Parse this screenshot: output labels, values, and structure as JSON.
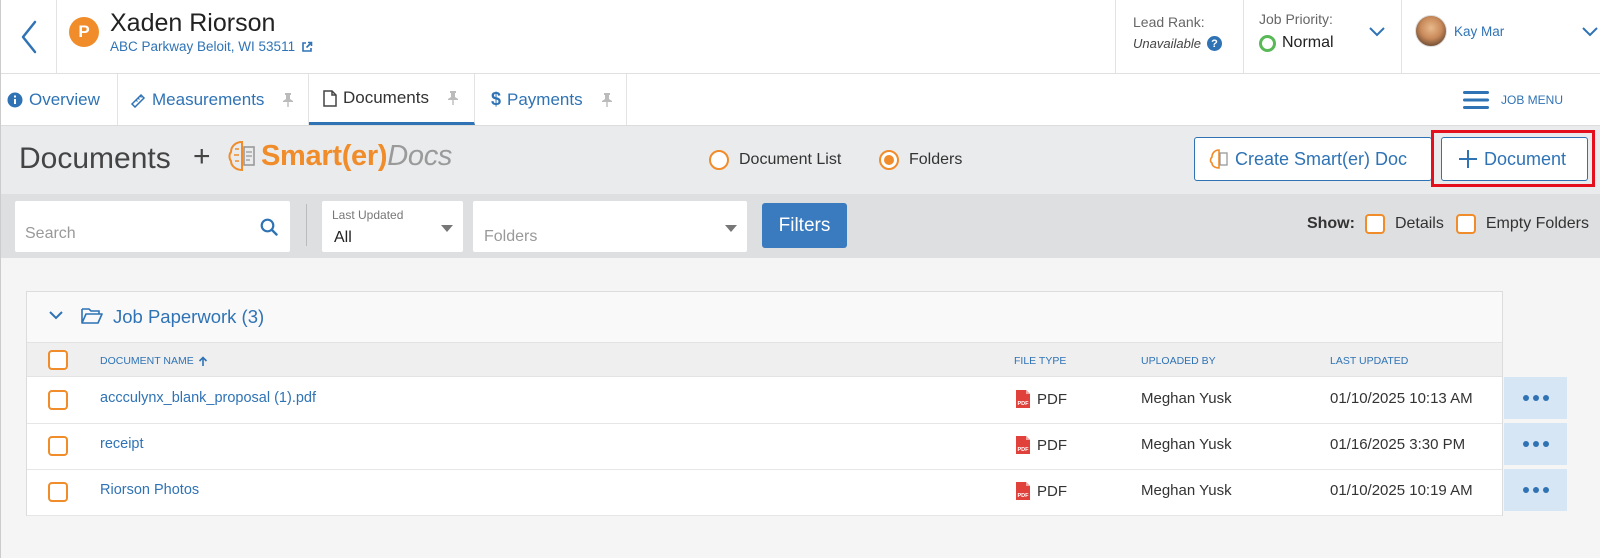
{
  "header": {
    "initial": "P",
    "job_name": "Xaden Riorson",
    "address": "ABC Parkway Beloit, WI 53511",
    "lead_rank_label": "Lead Rank:",
    "lead_rank_value": "Unavailable",
    "priority_label": "Job Priority:",
    "priority_value": "Normal",
    "user_name": "Kay Mar"
  },
  "tabs": [
    {
      "label": "Overview",
      "icon": "info-icon"
    },
    {
      "label": "Measurements",
      "icon": "ruler-icon"
    },
    {
      "label": "Documents",
      "icon": "document-icon",
      "active": true
    },
    {
      "label": "Payments",
      "icon": "dollar-icon"
    }
  ],
  "job_menu_label": "JOB MENU",
  "docs": {
    "title": "Documents",
    "plus": "+",
    "logo_smart": "Smart(er)",
    "logo_docs": "Docs",
    "view_document_list": "Document List",
    "view_folders": "Folders",
    "selected_view": "Folders",
    "create_button": "Create Smart(er) Doc",
    "add_document_button": "Document"
  },
  "filters": {
    "search_placeholder": "Search",
    "last_updated_label": "Last Updated",
    "last_updated_value": "All",
    "folders_placeholder": "Folders",
    "filters_button": "Filters",
    "show_label": "Show:",
    "details_label": "Details",
    "empty_folders_label": "Empty Folders"
  },
  "folder": {
    "title": "Job Paperwork (3)",
    "columns": {
      "name": "DOCUMENT NAME",
      "file_type": "FILE TYPE",
      "uploaded_by": "UPLOADED BY",
      "last_updated": "LAST UPDATED"
    },
    "rows": [
      {
        "name": "accculynx_blank_proposal (1).pdf",
        "file_type": "PDF",
        "uploaded_by": "Meghan Yusk",
        "last_updated": "01/10/2025 10:13 AM"
      },
      {
        "name": "receipt",
        "file_type": "PDF",
        "uploaded_by": "Meghan Yusk",
        "last_updated": "01/16/2025 3:30 PM"
      },
      {
        "name": "Riorson Photos",
        "file_type": "PDF",
        "uploaded_by": "Meghan Yusk",
        "last_updated": "01/10/2025 10:19 AM"
      }
    ]
  },
  "colors": {
    "accent_blue": "#2f73b5",
    "brand_orange": "#f08c2a",
    "priority_green": "#59b957",
    "highlight_red": "#e5101d"
  }
}
